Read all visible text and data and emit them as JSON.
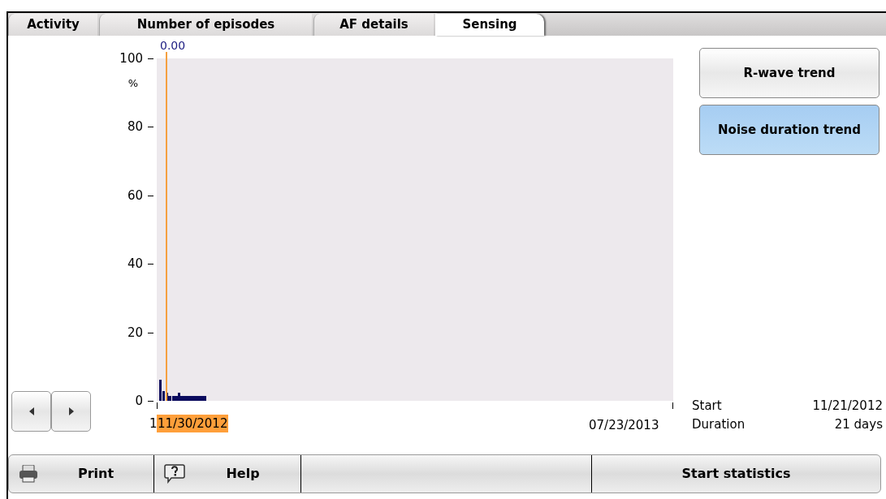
{
  "tabs": [
    {
      "label": "Activity",
      "selected": false
    },
    {
      "label": "Number of episodes",
      "selected": false
    },
    {
      "label": "AF details",
      "selected": false
    },
    {
      "label": "Sensing",
      "selected": true
    }
  ],
  "chart": {
    "y_ticks": [
      "100",
      "80",
      "60",
      "40",
      "20",
      "0"
    ],
    "y_unit": "%",
    "cursor_value": "0.00",
    "x_labels": [
      {
        "text": "1",
        "highlighted": false
      },
      {
        "text": "11/30/2012",
        "highlighted": true
      },
      {
        "text": "07/23/2013",
        "highlighted": false
      }
    ]
  },
  "trend_buttons": [
    {
      "label": "R-wave trend",
      "selected": false
    },
    {
      "label": "Noise duration trend",
      "selected": true
    }
  ],
  "summary": [
    {
      "label": "Start",
      "value": "11/21/2012"
    },
    {
      "label": "Duration",
      "value": "21 days"
    }
  ],
  "toolbar": [
    {
      "kind": "print",
      "label": "Print"
    },
    {
      "kind": "help",
      "label": "Help"
    },
    {
      "kind": "blank"
    },
    {
      "kind": "plain",
      "label": "Start statistics"
    }
  ]
}
